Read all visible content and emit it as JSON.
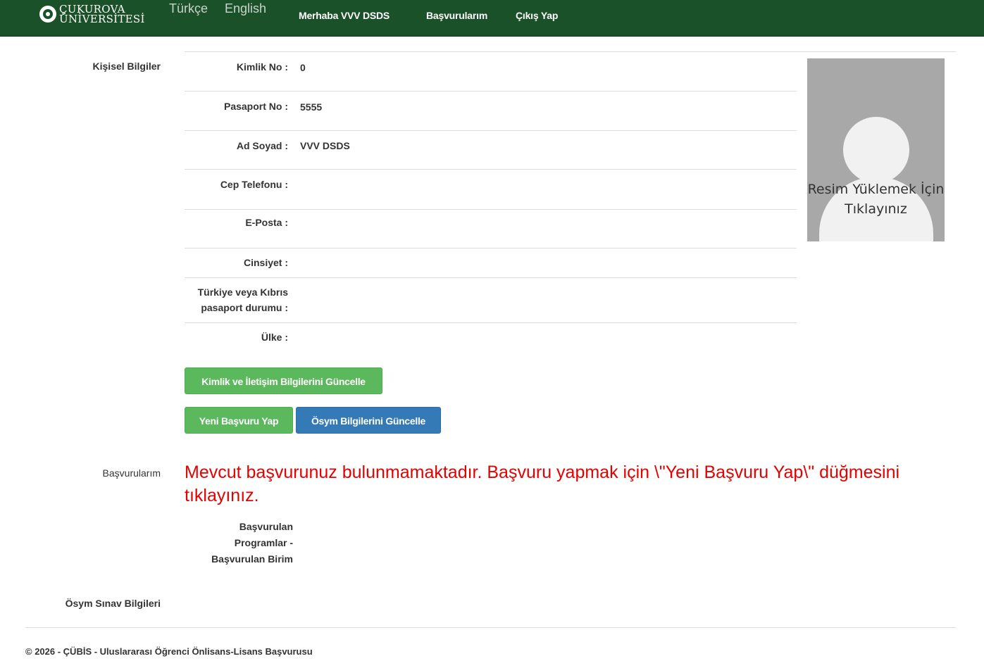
{
  "navbar": {
    "brand_line1": "ÇUKUROVA",
    "brand_line2": "ÜNİVERSİTESİ",
    "brand_icon": "university-logo-icon",
    "lang_tr": "Türkçe",
    "lang_en": "English",
    "greeting": "Merhaba VVV DSDS",
    "applications_link": "Başvurularım",
    "logout_link": "Çıkış Yap"
  },
  "personal": {
    "section_title": "Kişisel Bilgiler",
    "rows": [
      {
        "label": "Kimlik No :",
        "value": "0"
      },
      {
        "label": "Pasaport No :",
        "value": "5555"
      },
      {
        "label": "Ad Soyad :",
        "value": "VVV DSDS"
      },
      {
        "label": "Cep Telefonu :",
        "value": ""
      },
      {
        "label": "E-Posta :",
        "value": ""
      },
      {
        "label": "Cinsiyet :",
        "value": ""
      },
      {
        "label": "Türkiye veya Kıbrıs pasaport durumu :",
        "value": ""
      },
      {
        "label": "Ülke :",
        "value": ""
      }
    ],
    "photo_text": "Resim Yüklemek İçin Tıklayınız",
    "photo_icon": "avatar-placeholder-icon"
  },
  "buttons": {
    "update_identity": "Kimlik ve İletişim Bilgilerini Güncelle",
    "new_application": "Yeni Başvuru Yap",
    "update_osym": "Ösym Bilgilerini Güncelle"
  },
  "applications": {
    "section_title": "Başvurularım",
    "notice": "Mevcut başvurunuz bulunmamaktadır. Başvuru yapmak için \\\"Yeni Başvuru Yap\\\" düğmesini tıklayınız.",
    "programs_label": "Başvurulan Programlar - Başvurulan Birim"
  },
  "osym": {
    "section_title": "Ösym Sınav Bilgileri"
  },
  "footer": {
    "text": "© 2026 - ÇÜBİS - Uluslararası Öğrenci Önlisans-Lisans Başvurusu"
  },
  "colors": {
    "navbar": "#1b5128",
    "notice": "#e60000",
    "btn_green": "#5cb85c",
    "btn_blue": "#337ab7"
  }
}
